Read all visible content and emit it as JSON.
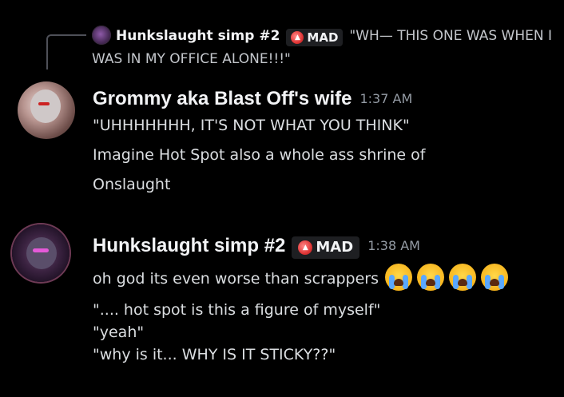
{
  "reply": {
    "author": "Hunkslaught simp #2",
    "badge": "MAD",
    "text": "\"WH— THIS ONE WAS WHEN I WAS IN MY OFFICE ALONE!!!\""
  },
  "messages": [
    {
      "author": "Grommy aka Blast Off's wife",
      "time": "1:37 AM",
      "lines": [
        "\"UHHHHHHH, IT'S NOT WHAT YOU THINK\"",
        "Imagine Hot Spot also a whole ass shrine of",
        "Onslaught"
      ]
    },
    {
      "author": "Hunkslaught simp #2",
      "badge": "MAD",
      "time": "1:38 AM",
      "lines": [
        "oh god its even worse than scrappers",
        "\".... hot spot is this a figure of myself\"",
        "\"yeah\"",
        "\"why is it... WHY IS IT STICKY??\""
      ],
      "emojis": [
        "loudly-crying-face",
        "loudly-crying-face",
        "loudly-crying-face",
        "loudly-crying-face"
      ]
    }
  ],
  "colors": {
    "background": "#000000",
    "name": "#f2f3f5",
    "text": "#dbdee1",
    "timestamp": "#949ba4",
    "badge_bg": "#1e1f22",
    "badge_icon": "#e03636"
  }
}
